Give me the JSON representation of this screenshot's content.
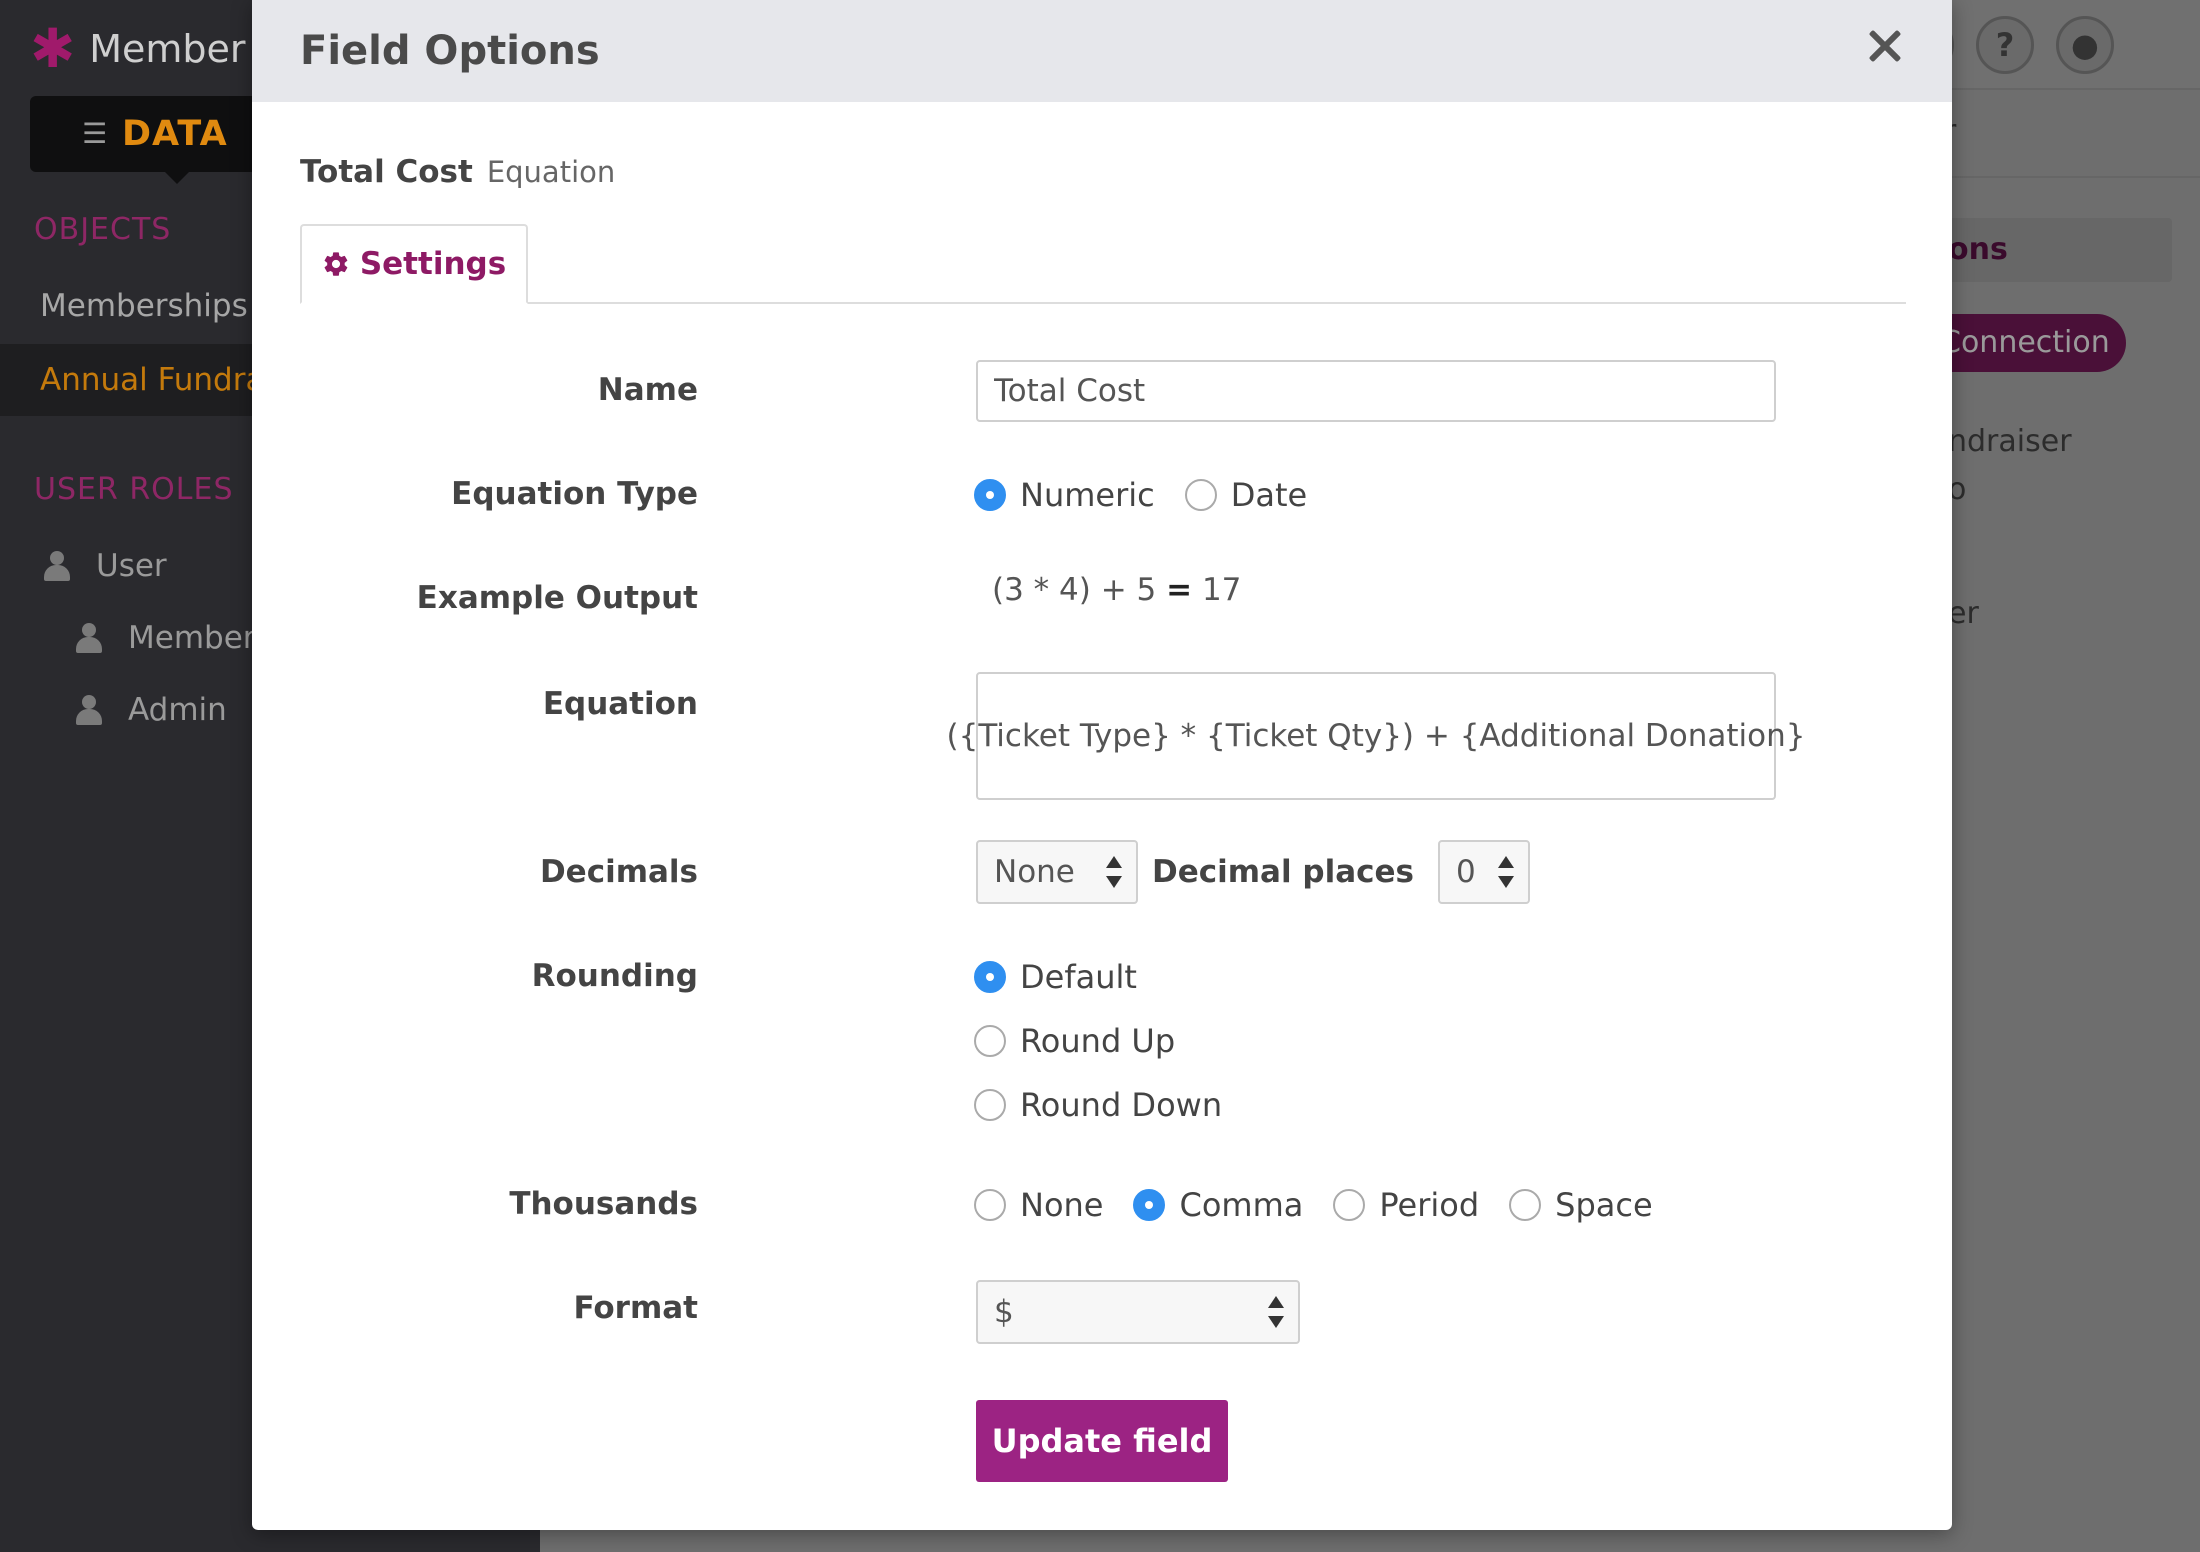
{
  "background": {
    "brand_name": "Member Database",
    "data_tab": "DATA",
    "objects_heading": "OBJECTS",
    "objects": [
      "Memberships",
      "Annual Fundraiser"
    ],
    "roles_heading": "USER ROLES",
    "roles": [
      "User",
      "Member",
      "Admin"
    ],
    "right_fragments": {
      "filter": "r",
      "tab": "ons",
      "connection": "Connection",
      "fundraiser": "ndraiser",
      "to": "o",
      "er": "er"
    },
    "top_icons": [
      "eye-icon",
      "help-icon",
      "user-icon"
    ]
  },
  "modal": {
    "title": "Field Options",
    "field_name": "Total Cost",
    "field_type": "Equation",
    "tab_settings": "Settings",
    "name_label": "Name",
    "name_value": "Total Cost",
    "equation_type_label": "Equation Type",
    "equation_type_options": [
      "Numeric",
      "Date"
    ],
    "equation_type_selected": "Numeric",
    "example_label": "Example Output",
    "example_expr": "(3 * 4) + 5",
    "example_eq": "=",
    "example_result": "17",
    "equation_label": "Equation",
    "equation_value": "({Ticket Type} * {Ticket Qty}) + {Additional Donation}",
    "decimals_label": "Decimals",
    "decimals_value": "None",
    "decimal_places_label": "Decimal places",
    "decimal_places_value": "0",
    "rounding_label": "Rounding",
    "rounding_options": [
      "Default",
      "Round Up",
      "Round Down"
    ],
    "rounding_selected": "Default",
    "thousands_label": "Thousands",
    "thousands_options": [
      "None",
      "Comma",
      "Period",
      "Space"
    ],
    "thousands_selected": "Comma",
    "format_label": "Format",
    "format_value": "$",
    "update_button": "Update field"
  },
  "colors": {
    "accent": "#9c2383",
    "radio_selected": "#2f8ff0"
  }
}
